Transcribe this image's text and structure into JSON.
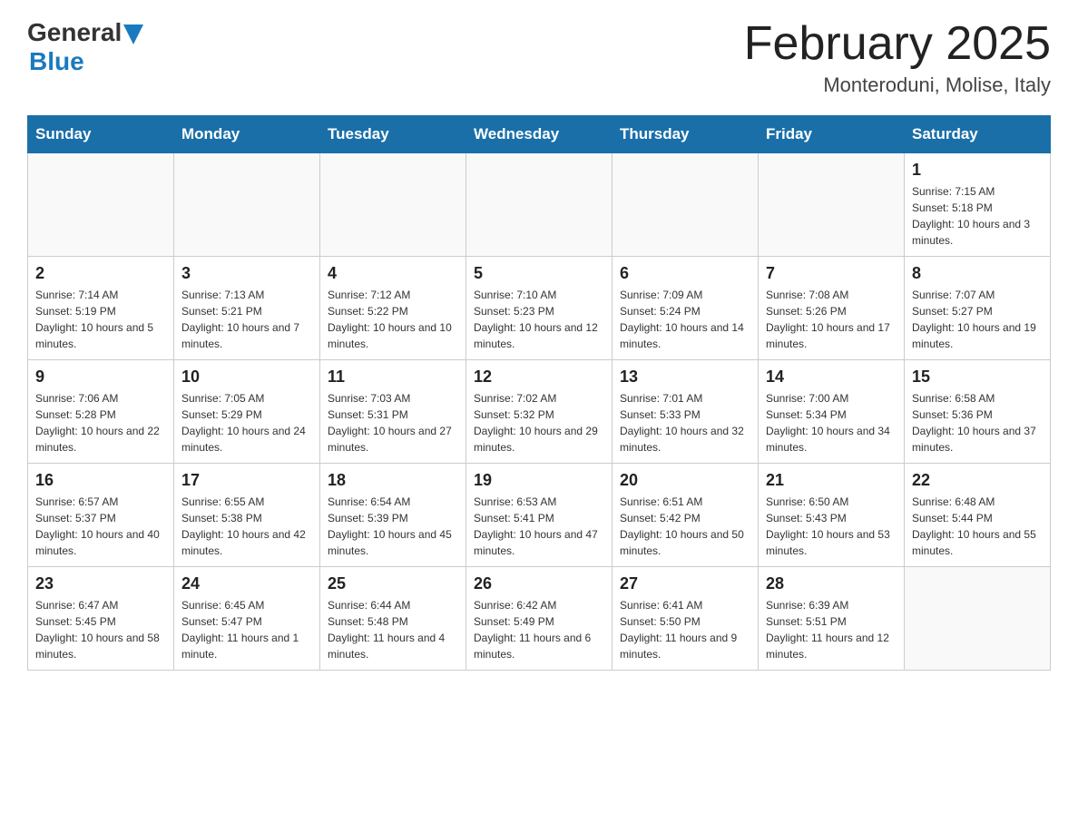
{
  "header": {
    "logo_general": "General",
    "logo_blue": "Blue",
    "title": "February 2025",
    "subtitle": "Monteroduni, Molise, Italy"
  },
  "weekdays": [
    "Sunday",
    "Monday",
    "Tuesday",
    "Wednesday",
    "Thursday",
    "Friday",
    "Saturday"
  ],
  "weeks": [
    [
      {
        "day": "",
        "info": ""
      },
      {
        "day": "",
        "info": ""
      },
      {
        "day": "",
        "info": ""
      },
      {
        "day": "",
        "info": ""
      },
      {
        "day": "",
        "info": ""
      },
      {
        "day": "",
        "info": ""
      },
      {
        "day": "1",
        "info": "Sunrise: 7:15 AM\nSunset: 5:18 PM\nDaylight: 10 hours and 3 minutes."
      }
    ],
    [
      {
        "day": "2",
        "info": "Sunrise: 7:14 AM\nSunset: 5:19 PM\nDaylight: 10 hours and 5 minutes."
      },
      {
        "day": "3",
        "info": "Sunrise: 7:13 AM\nSunset: 5:21 PM\nDaylight: 10 hours and 7 minutes."
      },
      {
        "day": "4",
        "info": "Sunrise: 7:12 AM\nSunset: 5:22 PM\nDaylight: 10 hours and 10 minutes."
      },
      {
        "day": "5",
        "info": "Sunrise: 7:10 AM\nSunset: 5:23 PM\nDaylight: 10 hours and 12 minutes."
      },
      {
        "day": "6",
        "info": "Sunrise: 7:09 AM\nSunset: 5:24 PM\nDaylight: 10 hours and 14 minutes."
      },
      {
        "day": "7",
        "info": "Sunrise: 7:08 AM\nSunset: 5:26 PM\nDaylight: 10 hours and 17 minutes."
      },
      {
        "day": "8",
        "info": "Sunrise: 7:07 AM\nSunset: 5:27 PM\nDaylight: 10 hours and 19 minutes."
      }
    ],
    [
      {
        "day": "9",
        "info": "Sunrise: 7:06 AM\nSunset: 5:28 PM\nDaylight: 10 hours and 22 minutes."
      },
      {
        "day": "10",
        "info": "Sunrise: 7:05 AM\nSunset: 5:29 PM\nDaylight: 10 hours and 24 minutes."
      },
      {
        "day": "11",
        "info": "Sunrise: 7:03 AM\nSunset: 5:31 PM\nDaylight: 10 hours and 27 minutes."
      },
      {
        "day": "12",
        "info": "Sunrise: 7:02 AM\nSunset: 5:32 PM\nDaylight: 10 hours and 29 minutes."
      },
      {
        "day": "13",
        "info": "Sunrise: 7:01 AM\nSunset: 5:33 PM\nDaylight: 10 hours and 32 minutes."
      },
      {
        "day": "14",
        "info": "Sunrise: 7:00 AM\nSunset: 5:34 PM\nDaylight: 10 hours and 34 minutes."
      },
      {
        "day": "15",
        "info": "Sunrise: 6:58 AM\nSunset: 5:36 PM\nDaylight: 10 hours and 37 minutes."
      }
    ],
    [
      {
        "day": "16",
        "info": "Sunrise: 6:57 AM\nSunset: 5:37 PM\nDaylight: 10 hours and 40 minutes."
      },
      {
        "day": "17",
        "info": "Sunrise: 6:55 AM\nSunset: 5:38 PM\nDaylight: 10 hours and 42 minutes."
      },
      {
        "day": "18",
        "info": "Sunrise: 6:54 AM\nSunset: 5:39 PM\nDaylight: 10 hours and 45 minutes."
      },
      {
        "day": "19",
        "info": "Sunrise: 6:53 AM\nSunset: 5:41 PM\nDaylight: 10 hours and 47 minutes."
      },
      {
        "day": "20",
        "info": "Sunrise: 6:51 AM\nSunset: 5:42 PM\nDaylight: 10 hours and 50 minutes."
      },
      {
        "day": "21",
        "info": "Sunrise: 6:50 AM\nSunset: 5:43 PM\nDaylight: 10 hours and 53 minutes."
      },
      {
        "day": "22",
        "info": "Sunrise: 6:48 AM\nSunset: 5:44 PM\nDaylight: 10 hours and 55 minutes."
      }
    ],
    [
      {
        "day": "23",
        "info": "Sunrise: 6:47 AM\nSunset: 5:45 PM\nDaylight: 10 hours and 58 minutes."
      },
      {
        "day": "24",
        "info": "Sunrise: 6:45 AM\nSunset: 5:47 PM\nDaylight: 11 hours and 1 minute."
      },
      {
        "day": "25",
        "info": "Sunrise: 6:44 AM\nSunset: 5:48 PM\nDaylight: 11 hours and 4 minutes."
      },
      {
        "day": "26",
        "info": "Sunrise: 6:42 AM\nSunset: 5:49 PM\nDaylight: 11 hours and 6 minutes."
      },
      {
        "day": "27",
        "info": "Sunrise: 6:41 AM\nSunset: 5:50 PM\nDaylight: 11 hours and 9 minutes."
      },
      {
        "day": "28",
        "info": "Sunrise: 6:39 AM\nSunset: 5:51 PM\nDaylight: 11 hours and 12 minutes."
      },
      {
        "day": "",
        "info": ""
      }
    ]
  ]
}
